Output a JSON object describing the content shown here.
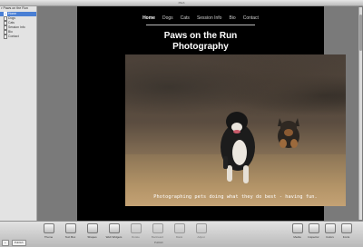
{
  "window": {
    "title": "iWeb"
  },
  "sidebar": {
    "site_name": "Paws on the Run",
    "pages": [
      {
        "label": "Home",
        "selected": true
      },
      {
        "label": "Dogs",
        "selected": false
      },
      {
        "label": "Cats",
        "selected": false
      },
      {
        "label": "Session Info",
        "selected": false
      },
      {
        "label": "Bio",
        "selected": false
      },
      {
        "label": "Contact",
        "selected": false
      }
    ]
  },
  "page": {
    "nav": [
      "Home",
      "Dogs",
      "Cats",
      "Session Info",
      "Bio",
      "Contact"
    ],
    "title_line1": "Paws on the Run",
    "title_line2": "Photography",
    "photo_caption": "Photographing pets doing what they do best - having fun."
  },
  "toolbar": {
    "add_label": "+",
    "publish_label": "Publish",
    "tools": [
      "Theme",
      "Text Box",
      "Shapes",
      "Web Widgets",
      "Rotate",
      "Backward",
      "Mask",
      "Adjust"
    ],
    "right_tools": [
      "Media",
      "Inspector",
      "Colors",
      "Fonts"
    ],
    "status": "Publish"
  },
  "colors": {
    "selection": "#4a7fd4",
    "page_bg": "#000000"
  }
}
